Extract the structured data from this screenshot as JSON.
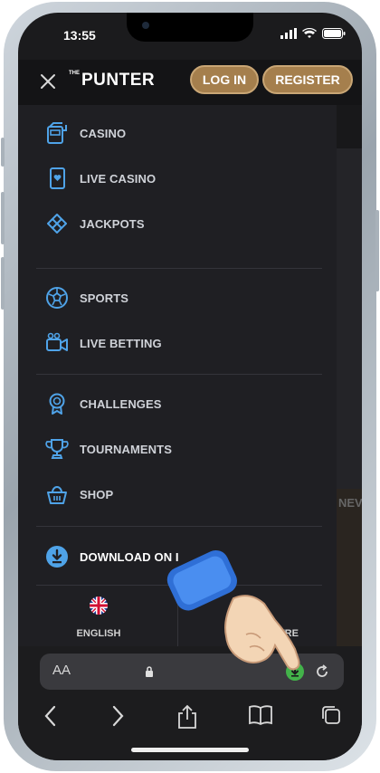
{
  "status_bar": {
    "time": "13:55"
  },
  "header": {
    "logo_prefix": "THE",
    "logo_text": "PUNTER",
    "login_label": "LOG IN",
    "register_label": "REGISTER"
  },
  "menu": {
    "group1": [
      {
        "label": "CASINO",
        "icon": "slot-machine-icon"
      },
      {
        "label": "LIVE CASINO",
        "icon": "card-icon"
      },
      {
        "label": "JACKPOTS",
        "icon": "clover-icon"
      }
    ],
    "group2": [
      {
        "label": "SPORTS",
        "icon": "soccer-ball-icon"
      },
      {
        "label": "LIVE BETTING",
        "icon": "video-camera-icon"
      }
    ],
    "group3": [
      {
        "label": "CHALLENGES",
        "icon": "medal-icon"
      },
      {
        "label": "TOURNAMENTS",
        "icon": "trophy-icon"
      },
      {
        "label": "SHOP",
        "icon": "basket-icon"
      }
    ],
    "download_label": "DOWNLOAD ON I",
    "language": {
      "label": "ENGLISH",
      "icon": "uk-flag-icon"
    },
    "help": {
      "label": "NTRE"
    }
  },
  "peek": {
    "text": "NEV"
  },
  "browser": {
    "aa_label": "AA",
    "icons": [
      "lock-icon",
      "download-icon",
      "reload-icon",
      "back-icon",
      "forward-icon",
      "share-icon",
      "bookmarks-icon",
      "tabs-icon"
    ]
  },
  "colors": {
    "accent_gold": "#a57f4d",
    "icon_blue": "#4fa3e8",
    "background": "#1f1f23",
    "download_green": "#43b34a"
  }
}
